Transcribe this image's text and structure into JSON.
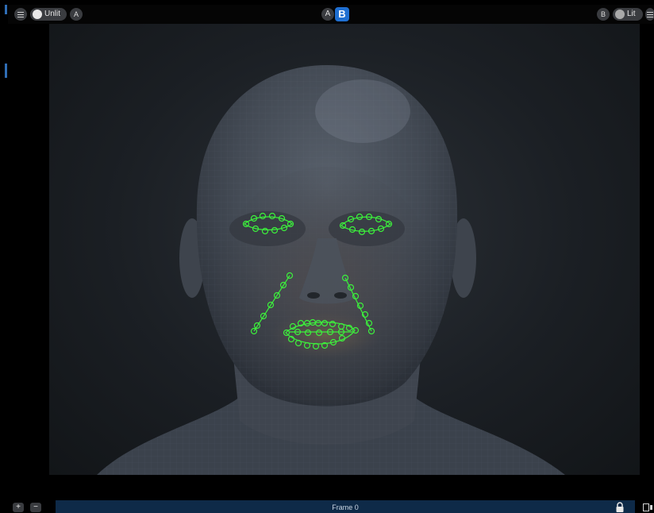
{
  "toolbar": {
    "left_label": "Unlit",
    "left_badge": "A",
    "compare_a": "A",
    "compare_b": "B",
    "right_badge": "B",
    "right_label": "Lit",
    "accent_color": "#1f6fd1"
  },
  "viewport": {
    "subject": "3D head mesh with facial landmark markers",
    "marker_color": "#3cf03c"
  },
  "footer": {
    "zoom_in_label": "+",
    "zoom_out_label": "−",
    "frame_label": "Frame 0"
  }
}
